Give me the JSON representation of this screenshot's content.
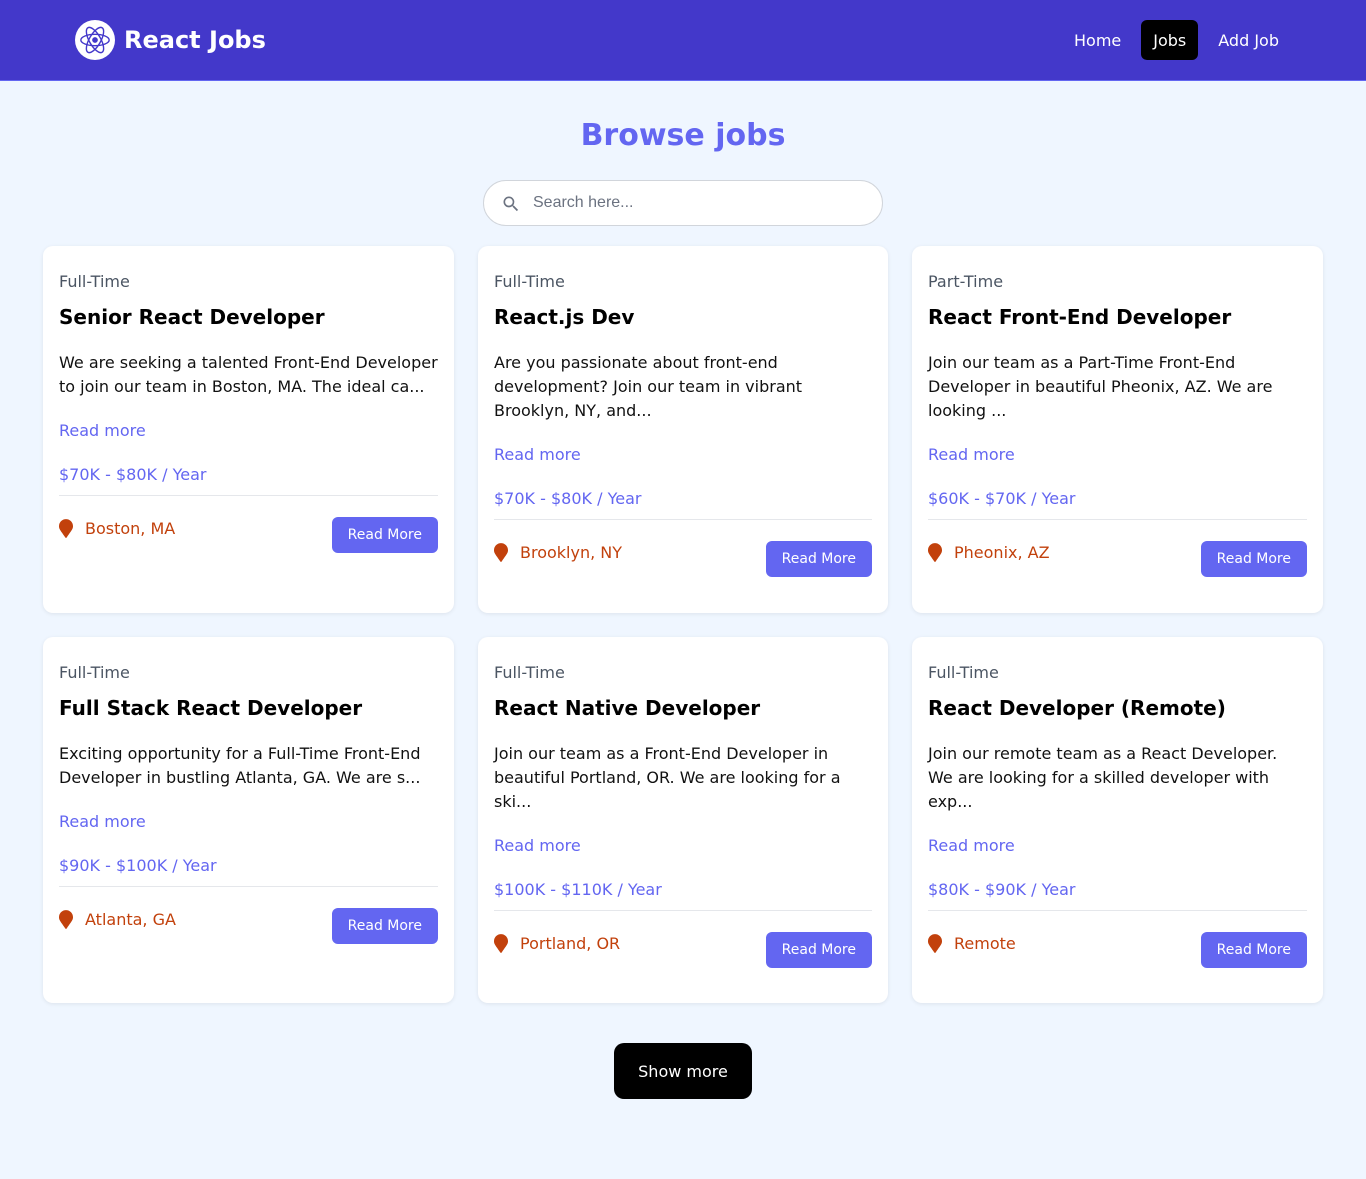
{
  "header": {
    "brand": "React Jobs",
    "nav": [
      {
        "label": "Home",
        "active": false
      },
      {
        "label": "Jobs",
        "active": true
      },
      {
        "label": "Add Job",
        "active": false
      }
    ]
  },
  "main": {
    "title": "Browse jobs",
    "search": {
      "placeholder": "Search here...",
      "value": ""
    },
    "jobs": [
      {
        "type": "Full-Time",
        "title": "Senior React Developer",
        "description": "We are seeking a talented Front-End Developer to join our team in Boston, MA. The ideal ca...",
        "read_link": "Read more",
        "salary": "$70K - $80K / Year",
        "location": "Boston, MA",
        "button": "Read More"
      },
      {
        "type": "Full-Time",
        "title": "React.js Dev",
        "description": "Are you passionate about front-end development? Join our team in vibrant Brooklyn, NY, and...",
        "read_link": "Read more",
        "salary": "$70K - $80K / Year",
        "location": "Brooklyn, NY",
        "button": "Read More"
      },
      {
        "type": "Part-Time",
        "title": "React Front-End Developer",
        "description": "Join our team as a Part-Time Front-End Developer in beautiful Pheonix, AZ. We are looking ...",
        "read_link": "Read more",
        "salary": "$60K - $70K / Year",
        "location": "Pheonix, AZ",
        "button": "Read More"
      },
      {
        "type": "Full-Time",
        "title": "Full Stack React Developer",
        "description": "Exciting opportunity for a Full-Time Front-End Developer in bustling Atlanta, GA. We are s...",
        "read_link": "Read more",
        "salary": "$90K - $100K / Year",
        "location": "Atlanta, GA",
        "button": "Read More"
      },
      {
        "type": "Full-Time",
        "title": "React Native Developer",
        "description": "Join our team as a Front-End Developer in beautiful Portland, OR. We are looking for a ski...",
        "read_link": "Read more",
        "salary": "$100K - $110K / Year",
        "location": "Portland, OR",
        "button": "Read More"
      },
      {
        "type": "Full-Time",
        "title": "React Developer (Remote)",
        "description": "Join our remote team as a React Developer. We are looking for a skilled developer with exp...",
        "read_link": "Read more",
        "salary": "$80K - $90K / Year",
        "location": "Remote",
        "button": "Read More"
      }
    ],
    "show_more": "Show more"
  },
  "colors": {
    "navbar": "#4338ca",
    "accent": "#6366f1",
    "location": "#c2410c",
    "background": "#eff6ff"
  },
  "icons": {
    "logo": "react-logo-icon",
    "search": "search-icon",
    "location": "map-pin-icon"
  }
}
